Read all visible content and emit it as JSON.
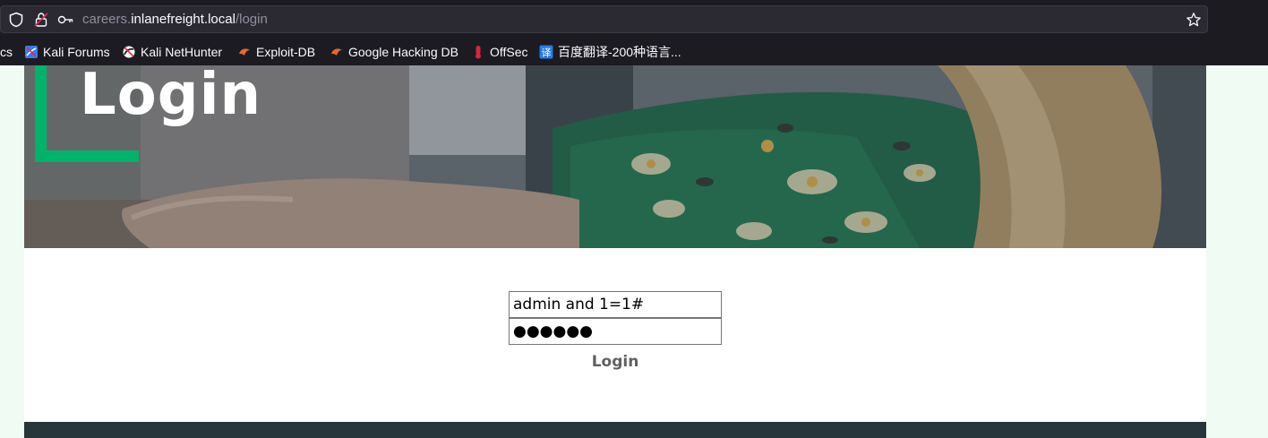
{
  "browser": {
    "url_subdomain": "careers.",
    "url_domain": "inlanefreight.local",
    "url_path": "/login",
    "bookmarks": [
      {
        "label": "cs",
        "icon": "none"
      },
      {
        "label": "Kali Forums",
        "icon": "kali-forums-icon"
      },
      {
        "label": "Kali NetHunter",
        "icon": "kali-nethunter-icon"
      },
      {
        "label": "Exploit-DB",
        "icon": "exploit-db-icon"
      },
      {
        "label": "Google Hacking DB",
        "icon": "ghdb-icon"
      },
      {
        "label": "OffSec",
        "icon": "offsec-icon"
      },
      {
        "label": "百度翻译-200种语言...",
        "icon": "baidu-translate-icon"
      }
    ]
  },
  "hero": {
    "title": "Login"
  },
  "form": {
    "username_value": "admin and 1=1#",
    "password_mask": "●●●●●●",
    "submit_label": "Login"
  },
  "colors": {
    "accent": "#00b36b",
    "footer": "#27363a",
    "page_bg": "#f0fbf3"
  }
}
